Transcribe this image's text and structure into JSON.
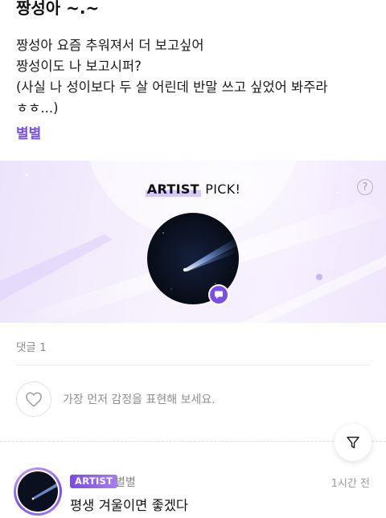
{
  "post": {
    "title": "짱성아 ~.~",
    "lines": [
      "짱성아 요즘 추워져서 더 보고싶어",
      "짱성이도 나 보고시퍼?",
      "(사실 나 성이보다 두 살 어린데 반말 쓰고 싶었어 봐주라",
      "ㅎㅎ...)"
    ],
    "author": "별별"
  },
  "artist_pick": {
    "highlight": "ARTIST",
    "suffix": " PICK!",
    "help_glyph": "?"
  },
  "comments_section": {
    "count_label": "댓글 1",
    "reaction_prompt": "가장 먼저 감정을 표현해 보세요."
  },
  "comment": {
    "badge": "ARTIST",
    "author": "별별",
    "time": "1시간 전",
    "text": "평생 겨울이면 좋겠다"
  },
  "icons": {
    "help": "help-circle-icon",
    "chat": "chat-bubble-icon",
    "heart": "heart-outline-icon",
    "filter": "filter-funnel-icon"
  },
  "colors": {
    "accent": "#7b4ee8",
    "author_link": "#7a4fe0",
    "banner_bg": "#f3edfd"
  }
}
